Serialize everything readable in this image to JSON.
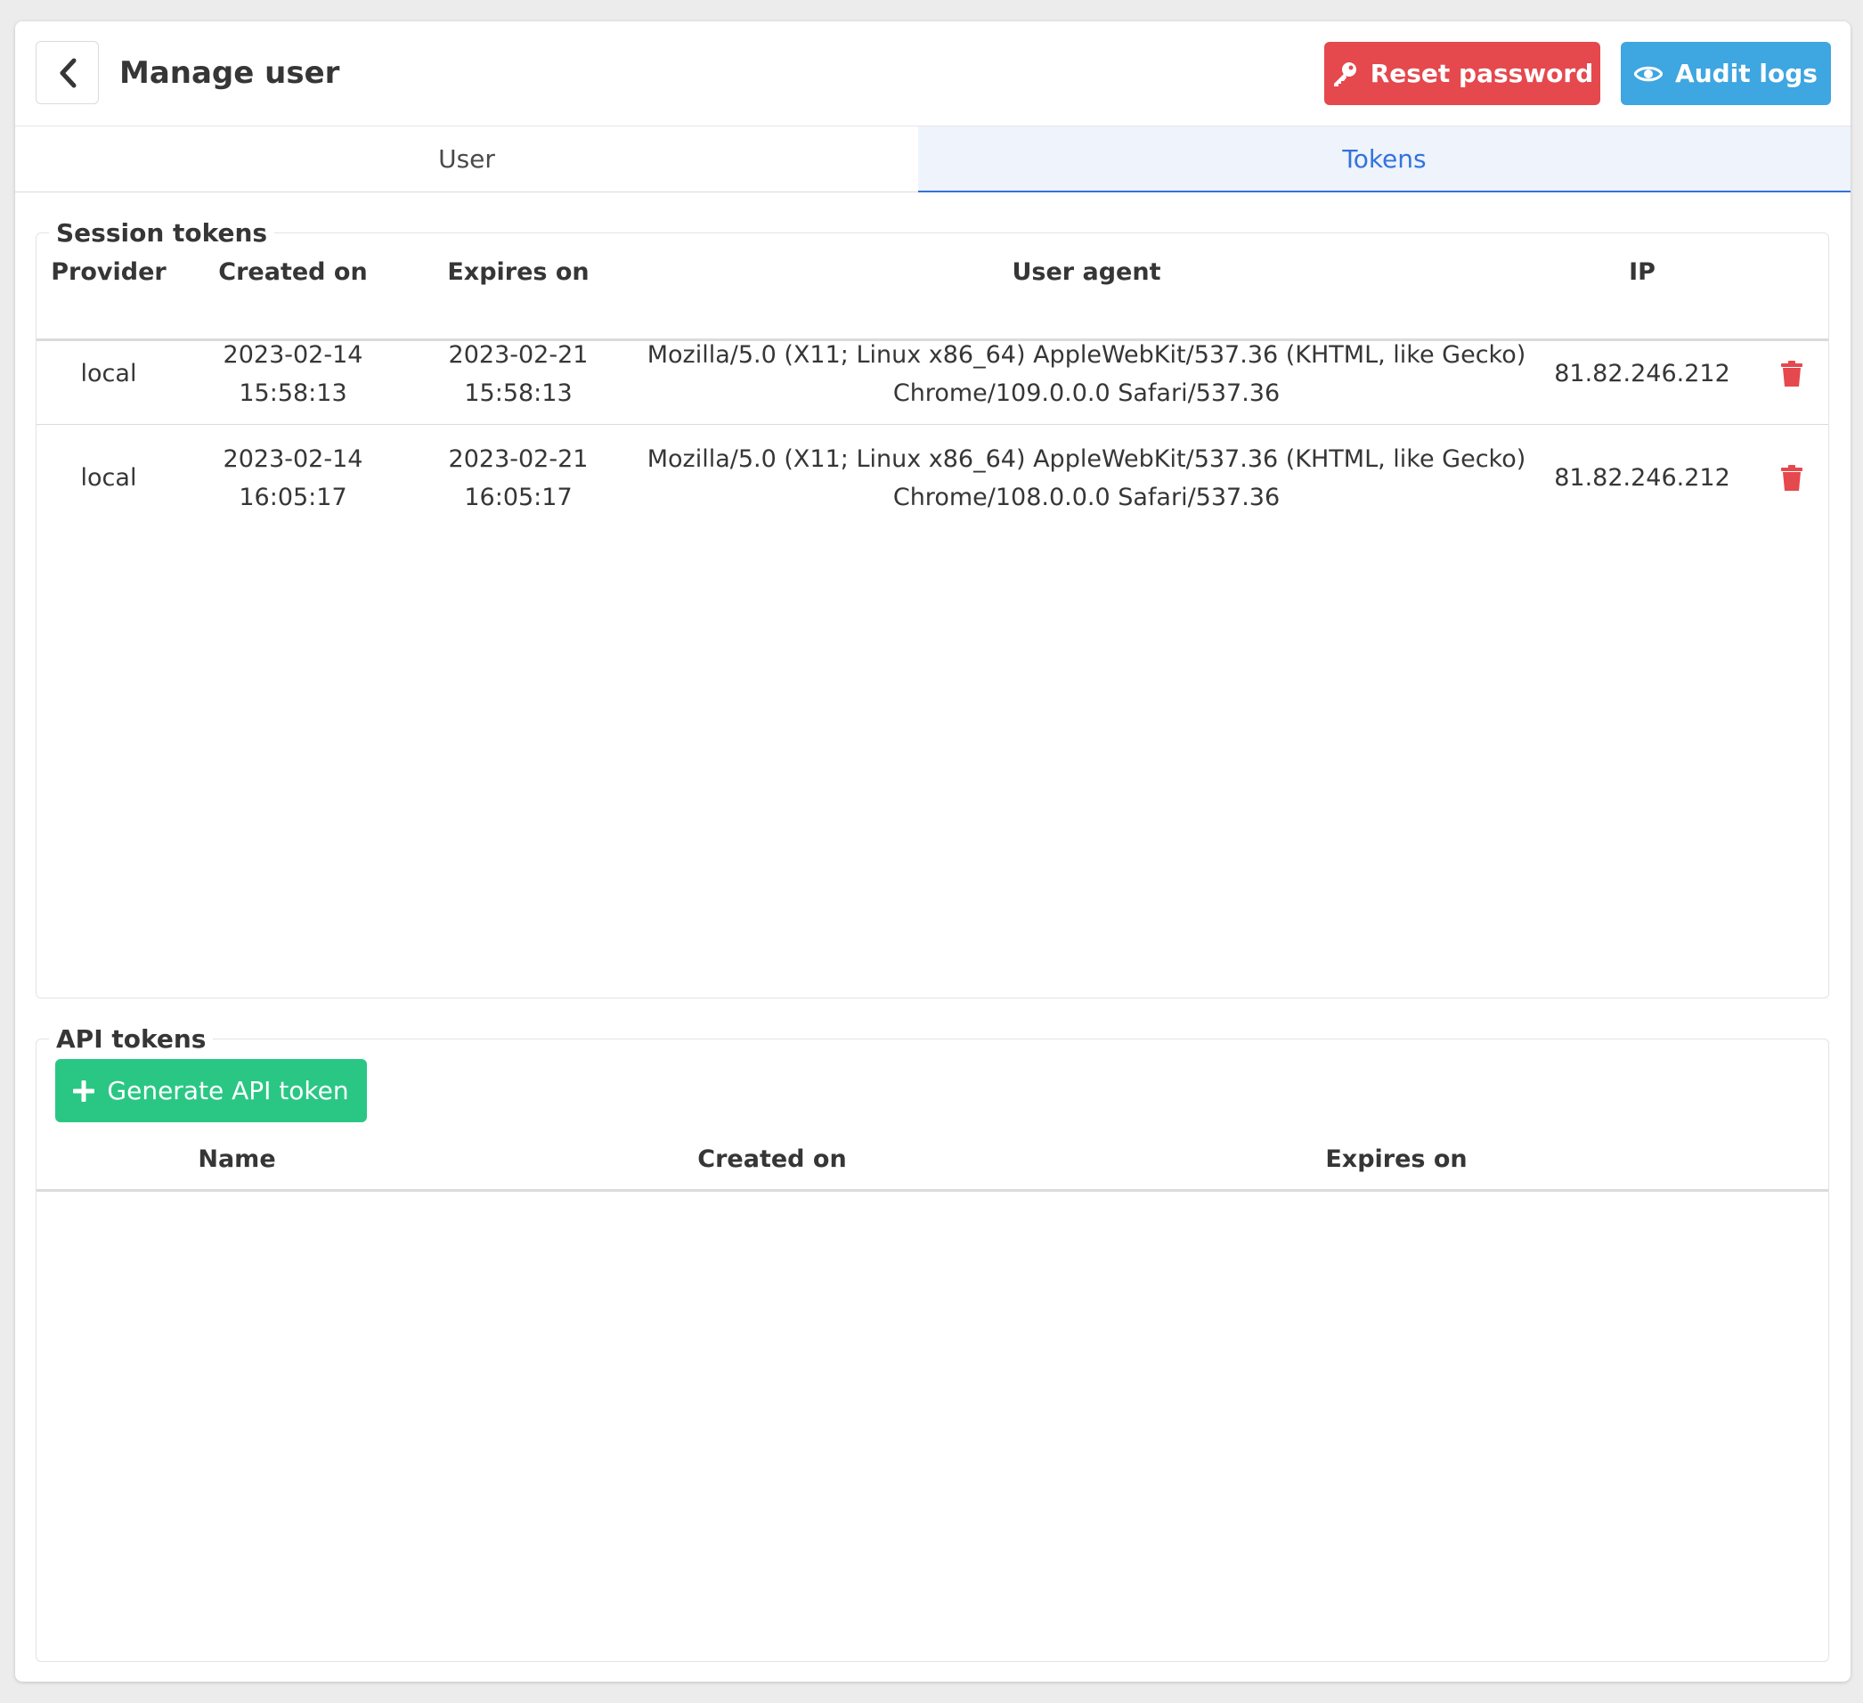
{
  "header": {
    "title": "Manage user",
    "reset_password_label": "Reset password",
    "audit_logs_label": "Audit logs"
  },
  "tabs": [
    {
      "label": "User",
      "active": false
    },
    {
      "label": "Tokens",
      "active": true
    }
  ],
  "session_tokens": {
    "legend": "Session tokens",
    "columns": [
      "Provider",
      "Created on",
      "Expires on",
      "User agent",
      "IP"
    ],
    "rows": [
      {
        "provider": "local",
        "created_date": "2023-02-14",
        "created_time": "15:58:13",
        "expires_date": "2023-02-21",
        "expires_time": "15:58:13",
        "ua_line1": "Mozilla/5.0 (X11; Linux x86_64) AppleWebKit/537.36 (KHTML, like Gecko)",
        "ua_line2": "Chrome/109.0.0.0 Safari/537.36",
        "ip": "81.82.246.212"
      },
      {
        "provider": "local",
        "created_date": "2023-02-14",
        "created_time": "16:05:17",
        "expires_date": "2023-02-21",
        "expires_time": "16:05:17",
        "ua_line1": "Mozilla/5.0 (X11; Linux x86_64) AppleWebKit/537.36 (KHTML, like Gecko)",
        "ua_line2": "Chrome/108.0.0.0 Safari/537.36",
        "ip": "81.82.246.212"
      }
    ]
  },
  "api_tokens": {
    "legend": "API tokens",
    "generate_label": "Generate API token",
    "columns": [
      "Name",
      "Created on",
      "Expires on"
    ]
  },
  "colors": {
    "danger": "#e5484d",
    "info": "#3ea6e0",
    "success": "#2ac784",
    "link": "#3273dc"
  },
  "icons": {
    "back": "chevron-left-icon",
    "reset": "key-icon",
    "audit": "eye-icon",
    "delete": "trash-icon",
    "generate": "plus-icon"
  }
}
